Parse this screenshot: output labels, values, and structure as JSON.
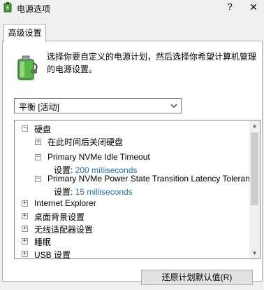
{
  "window": {
    "title": "电源选项",
    "help": "?",
    "close": "✕"
  },
  "tabs": [
    {
      "label": "高级设置",
      "active": true
    }
  ],
  "panel": {
    "description_line1": "选择你要自定义的电源计划，然后选择你希望计算机管理",
    "description_line2": "的电源设置。"
  },
  "plan_select": {
    "value": "平衡 [活动]"
  },
  "tree": {
    "hard_disk": {
      "label": "硬盘",
      "expanded": true
    },
    "turn_off_disk": {
      "label": "在此时间后关闭硬盘",
      "expanded": false
    },
    "nvme_idle": {
      "label": "Primary NVMe Idle Timeout",
      "setting_label": "设置:",
      "setting_value": "200 milliseconds"
    },
    "nvme_latency": {
      "label": "Primary NVMe Power State Transition Latency Tolerance",
      "setting_label": "设置:",
      "setting_value": "15 milliseconds"
    },
    "items": [
      {
        "label": "Internet Explorer"
      },
      {
        "label": "桌面背景设置"
      },
      {
        "label": "无线适配器设置"
      },
      {
        "label": "睡眠"
      },
      {
        "label": "USB 设置"
      }
    ],
    "expand_symbol": "+",
    "collapse_symbol": "−"
  },
  "buttons": {
    "restore_defaults": "还原计划默认值(R)"
  },
  "colors": {
    "setting_value": "#1f6fb2",
    "tab_bg": "#ffffff",
    "window_bg": "#f0f0f0"
  },
  "icons": {
    "title": "power-options-icon",
    "battery": "battery-plug-icon",
    "dropdown": "chevron-down-icon"
  }
}
